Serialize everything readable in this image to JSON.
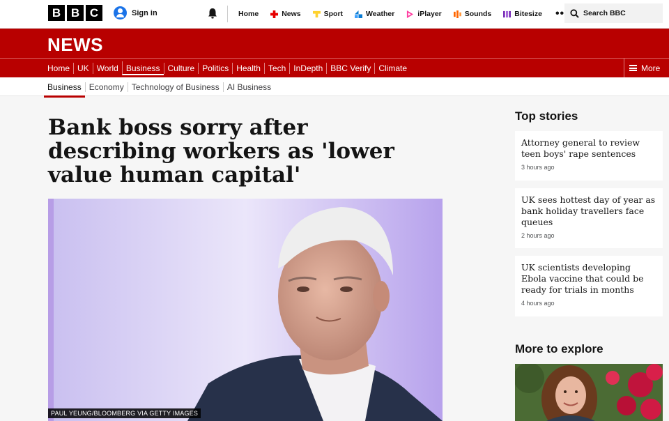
{
  "topbar": {
    "logo_letters": [
      "B",
      "B",
      "C"
    ],
    "signin_label": "Sign in",
    "nav": [
      {
        "label": "Home",
        "icon": "none"
      },
      {
        "label": "News",
        "icon": "news-icon"
      },
      {
        "label": "Sport",
        "icon": "sport-icon"
      },
      {
        "label": "Weather",
        "icon": "weather-icon"
      },
      {
        "label": "iPlayer",
        "icon": "iplayer-icon"
      },
      {
        "label": "Sounds",
        "icon": "sounds-icon"
      },
      {
        "label": "Bitesize",
        "icon": "bitesize-icon"
      }
    ],
    "more_label": "•••",
    "search_label": "Search BBC"
  },
  "news": {
    "title": "NEWS",
    "sections": [
      "Home",
      "UK",
      "World",
      "Business",
      "Culture",
      "Politics",
      "Health",
      "Tech",
      "InDepth",
      "BBC Verify",
      "Climate"
    ],
    "active_section": "Business",
    "more_label": "More"
  },
  "subnav": {
    "items": [
      "Business",
      "Economy",
      "Technology of Business",
      "AI Business"
    ]
  },
  "article": {
    "headline": "Bank boss sorry after describing workers as 'lower value human capital'",
    "image_caption": "PAUL YEUNG/BLOOMBERG VIA GETTY IMAGES"
  },
  "sidebar": {
    "top_stories_heading": "Top stories",
    "stories": [
      {
        "title": "Attorney general to review teen boys' rape sentences",
        "time": "3 hours ago"
      },
      {
        "title": "UK sees hottest day of year as bank holiday travellers face queues",
        "time": "2 hours ago"
      },
      {
        "title": "UK scientists developing Ebola vaccine that could be ready for trials in months",
        "time": "4 hours ago"
      }
    ],
    "explore_heading": "More to explore"
  },
  "colors": {
    "brand_red": "#b80000",
    "news_icon": "#e60000",
    "sport_icon": "#ffd230",
    "weather_icon": "#0a7bd2",
    "iplayer_icon": "#ff3ca0",
    "sounds_icon": "#ff6600",
    "bitesize_icon": "#7a2fb8"
  }
}
